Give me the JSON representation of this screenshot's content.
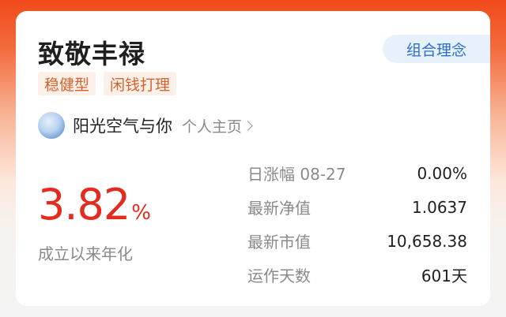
{
  "fund": {
    "name": "致敬丰禄",
    "concept_button": "组合理念",
    "tags": [
      "稳健型",
      "闲钱打理"
    ]
  },
  "author": {
    "name": "阳光空气与你",
    "profile_link": "个人主页"
  },
  "return": {
    "value": "3.82",
    "unit": "%",
    "label": "成立以来年化"
  },
  "stats": [
    {
      "label": "日涨幅 08-27",
      "value": "0.00%"
    },
    {
      "label": "最新净值",
      "value": "1.0637"
    },
    {
      "label": "最新市值",
      "value": "10,658.38"
    },
    {
      "label": "运作天数",
      "value": "601天"
    }
  ],
  "colors": {
    "accent_red": "#e32b1e",
    "tag_orange": "#d4622e",
    "concept_blue": "#2a6fc8"
  }
}
